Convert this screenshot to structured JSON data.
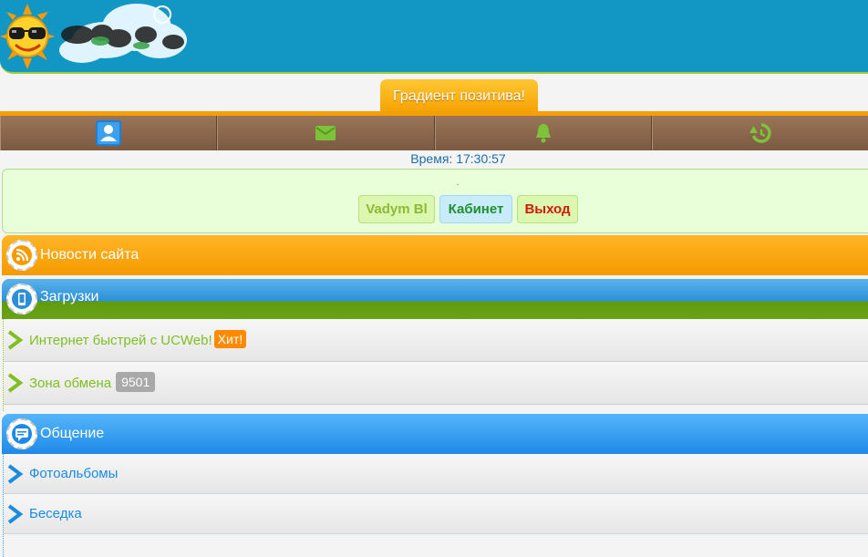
{
  "header": {
    "logo_icon": "sun-with-sunglasses"
  },
  "tab": {
    "slogan": "Градиент позитива!"
  },
  "navbar": {
    "items": [
      {
        "icon": "user-icon"
      },
      {
        "icon": "mail-icon"
      },
      {
        "icon": "bell-icon"
      },
      {
        "icon": "history-icon"
      }
    ]
  },
  "status": {
    "time": "Время: 17:30:57"
  },
  "user_panel": {
    "username": "Vadym Bl",
    "cabinet_label": "Кабинет",
    "logout_label": "Выход"
  },
  "sections": {
    "news": {
      "title": "Новости сайта",
      "icon": "rss-icon"
    },
    "downloads": {
      "title": "Загрузки",
      "icon": "phone-icon",
      "items": [
        {
          "label": "Интернет быстрей с UCWeb!",
          "badge": "Хит!"
        },
        {
          "label": "Зона обмена",
          "count": "9501"
        }
      ]
    },
    "chat": {
      "title": "Общение",
      "icon": "chat-bubble-icon",
      "items": [
        {
          "label": "Фотоальбомы"
        },
        {
          "label": "Беседка"
        }
      ]
    }
  },
  "colors": {
    "header_blue": "#1296c3",
    "orange": "#f5a000",
    "nav_brown": "#8a684d",
    "green_text": "#7fbf22",
    "blue_text": "#1a8ce0"
  }
}
